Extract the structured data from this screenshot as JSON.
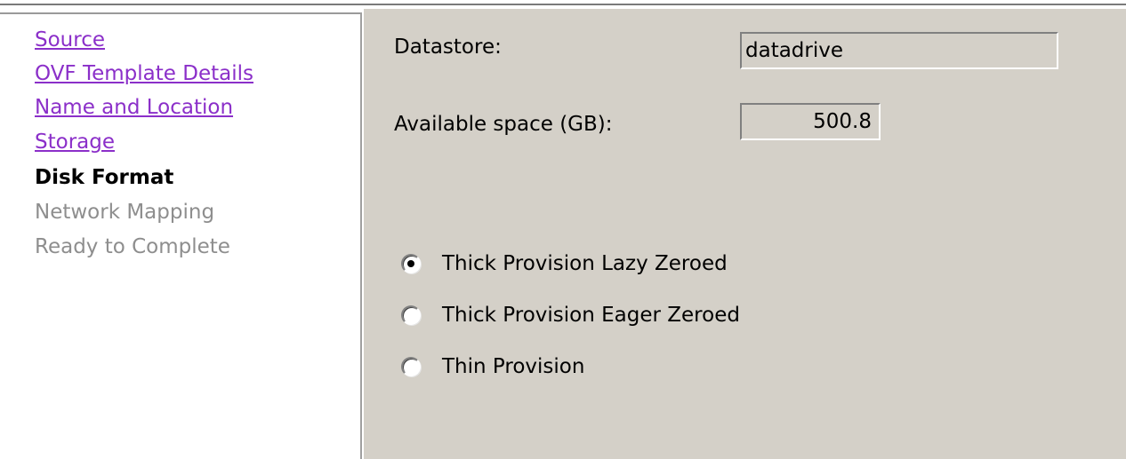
{
  "nav": {
    "items": [
      {
        "label": "Source",
        "state": "link"
      },
      {
        "label": "OVF Template Details",
        "state": "link"
      },
      {
        "label": "Name and Location",
        "state": "link"
      },
      {
        "label": "Storage",
        "state": "link"
      },
      {
        "label": "Disk Format",
        "state": "current"
      },
      {
        "label": "Network Mapping",
        "state": "disabled"
      },
      {
        "label": "Ready to Complete",
        "state": "disabled"
      }
    ]
  },
  "datastore": {
    "label": "Datastore:",
    "value": "datadrive"
  },
  "available_space": {
    "label": "Available space (GB):",
    "value": "500.8"
  },
  "disk_format": {
    "options": [
      {
        "label": "Thick Provision Lazy Zeroed",
        "selected": true
      },
      {
        "label": "Thick Provision Eager Zeroed",
        "selected": false
      },
      {
        "label": "Thin Provision",
        "selected": false
      }
    ]
  },
  "colors": {
    "panel_bg": "#d4d0c8",
    "link": "#8b2fc9",
    "disabled": "#8e8e8e"
  }
}
